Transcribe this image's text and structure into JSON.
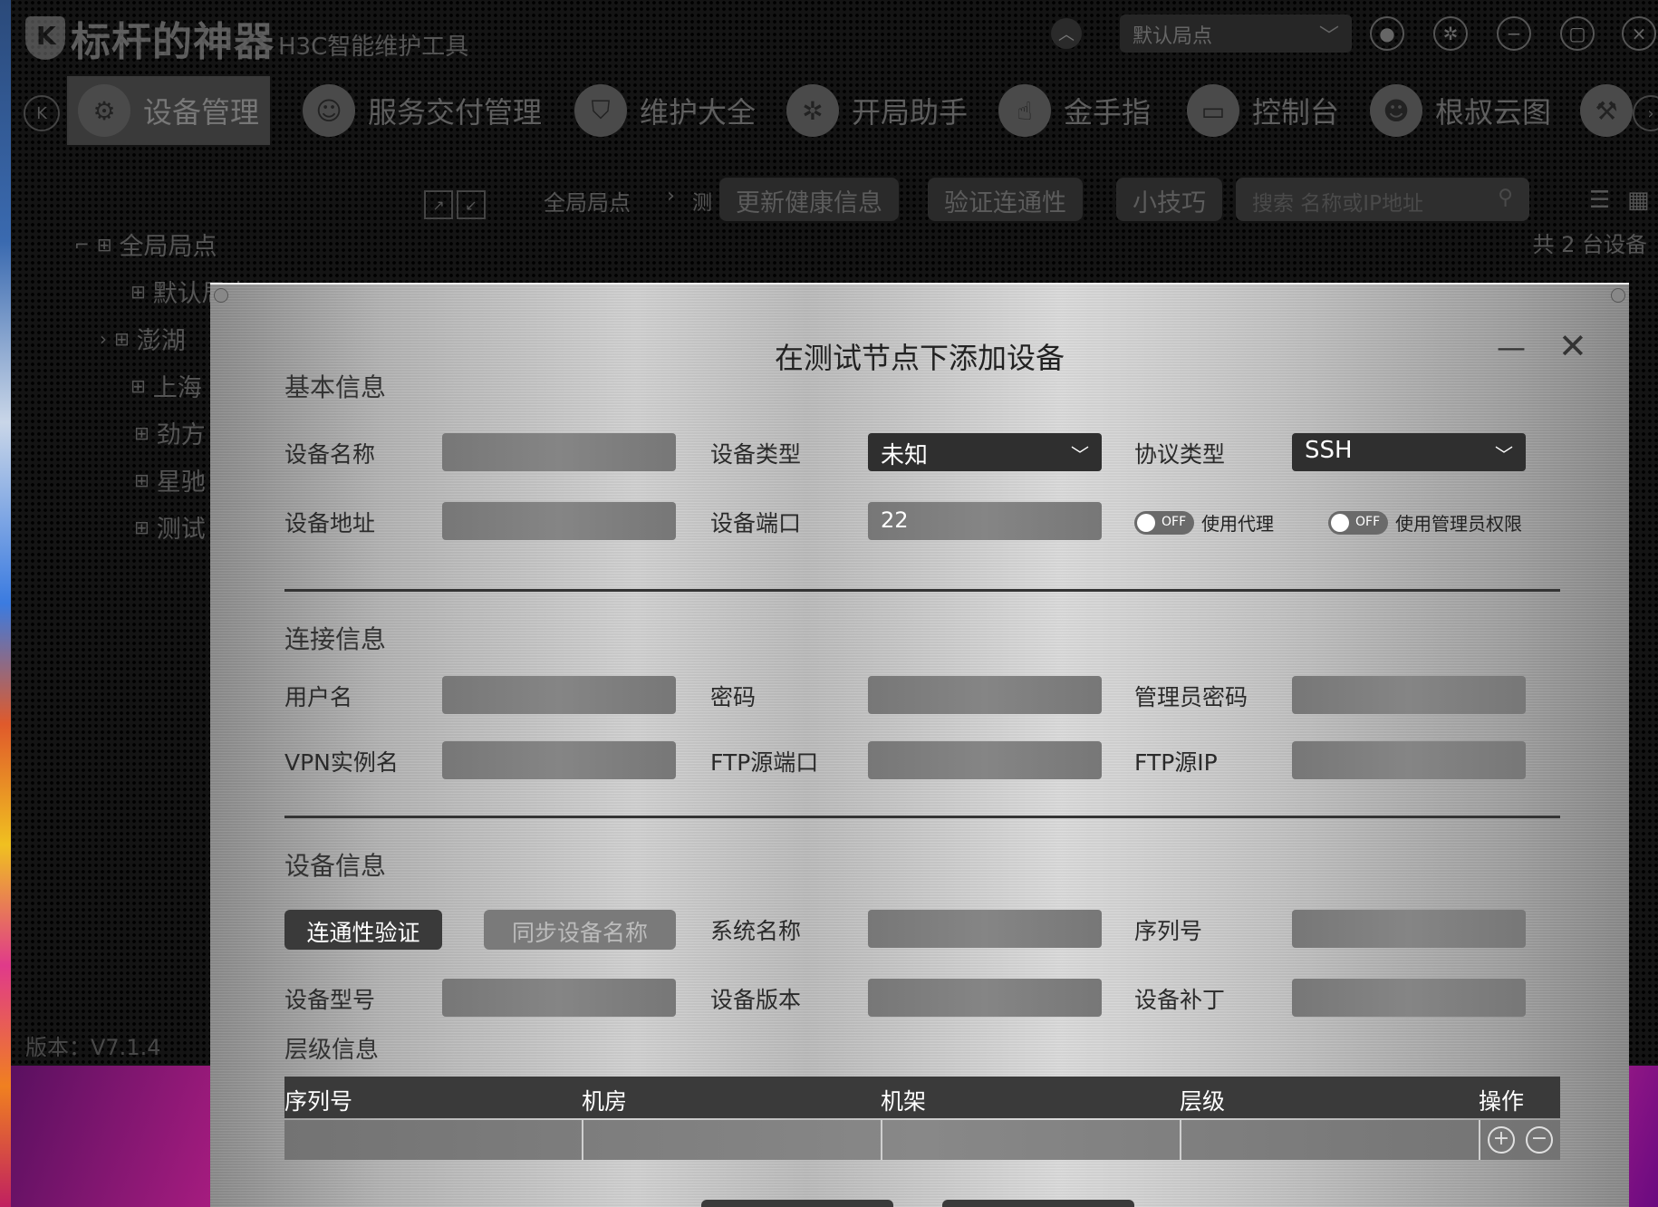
{
  "app": {
    "title": "标杆的神器",
    "subtitle": "H3C智能维护工具",
    "site_select": "默认局点",
    "version": "版本：V7.1.4"
  },
  "nav": {
    "items": [
      {
        "label": "设备管理",
        "icon": "device-gear-icon"
      },
      {
        "label": "服务交付管理",
        "icon": "service-hand-icon"
      },
      {
        "label": "维护大全",
        "icon": "shield-icon"
      },
      {
        "label": "开局助手",
        "icon": "gear-icon"
      },
      {
        "label": "金手指",
        "icon": "finger-icon"
      },
      {
        "label": "控制台",
        "icon": "terminal-icon"
      },
      {
        "label": "根叔云图",
        "icon": "avatar-icon"
      }
    ]
  },
  "toolbar": {
    "breadcrumb": "全局局点",
    "breadcrumb_next": "测",
    "btn_health": "更新健康信息",
    "btn_verify": "验证连通性",
    "btn_tips": "小技巧",
    "search_placeholder": "搜索 名称或IP地址",
    "device_count": "共 2 台设备"
  },
  "tree": {
    "root": "全局局点",
    "children": [
      "默认局点",
      "澎湖",
      "上海",
      "劲方",
      "星驰",
      "测试"
    ]
  },
  "dialog": {
    "title": "在测试节点下添加设备",
    "basic": {
      "section": "基本信息",
      "device_name_label": "设备名称",
      "device_name_value": "",
      "device_type_label": "设备类型",
      "device_type_value": "未知",
      "protocol_label": "协议类型",
      "protocol_value": "SSH",
      "address_label": "设备地址",
      "address_value": "",
      "port_label": "设备端口",
      "port_value": "22",
      "proxy_toggle_state": "OFF",
      "proxy_label": "使用代理",
      "admin_toggle_state": "OFF",
      "admin_label": "使用管理员权限"
    },
    "connection": {
      "section": "连接信息",
      "username_label": "用户名",
      "password_label": "密码",
      "admin_password_label": "管理员密码",
      "vpn_label": "VPN实例名",
      "ftp_port_label": "FTP源端口",
      "ftp_ip_label": "FTP源IP"
    },
    "device_info": {
      "section": "设备信息",
      "btn_verify": "连通性验证",
      "btn_sync": "同步设备名称",
      "sysname_label": "系统名称",
      "serial_label": "序列号",
      "model_label": "设备型号",
      "version_label": "设备版本",
      "patch_label": "设备补丁"
    },
    "hierarchy": {
      "section": "层级信息",
      "columns": [
        "序列号",
        "机房",
        "机架",
        "层级",
        "操作"
      ]
    }
  }
}
